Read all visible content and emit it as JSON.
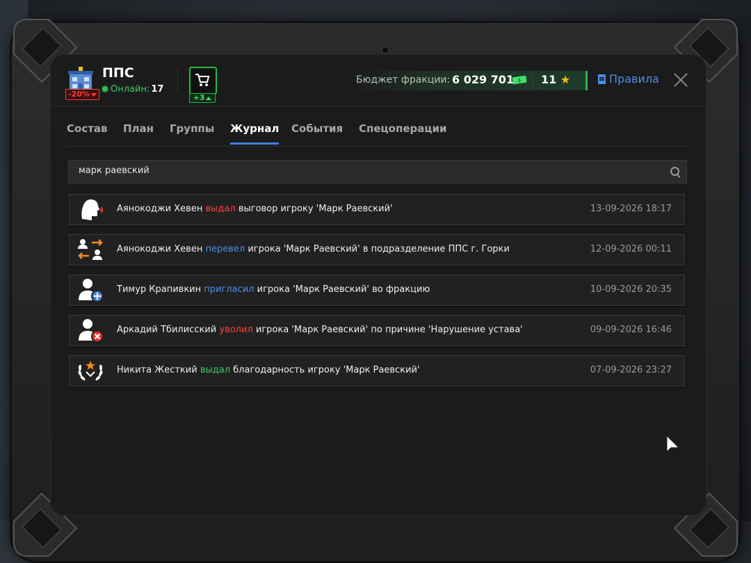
{
  "faction": {
    "name": "ППС",
    "discount": "-20%",
    "online_label": "Онлайн:",
    "online_count": "17"
  },
  "shop": {
    "badge": "+3"
  },
  "budget": {
    "label": "Бюджет фракции:",
    "value": "6 029 701",
    "stars": "11"
  },
  "rules_label": "Правила",
  "tabs": [
    {
      "label": "Состав",
      "active": false
    },
    {
      "label": "План",
      "active": false
    },
    {
      "label": "Группы",
      "active": false
    },
    {
      "label": "Журнал",
      "active": true
    },
    {
      "label": "События",
      "active": false
    },
    {
      "label": "Спецоперации",
      "active": false
    }
  ],
  "search": {
    "value": "марк раевский"
  },
  "log": [
    {
      "icon": "speaking-head-icon",
      "actor": "Аянокоджи Хевен",
      "action": "выдал",
      "action_color": "red",
      "rest": "выговор игроку 'Марк Раевский'",
      "date": "13-09-2026 18:17"
    },
    {
      "icon": "transfer-users-icon",
      "actor": "Аянокоджи Хевен",
      "action": "перевел",
      "action_color": "blue",
      "rest": "игрока 'Марк Раевский' в подразделение ППС г. Горки",
      "date": "12-09-2026 00:11"
    },
    {
      "icon": "user-add-icon",
      "actor": "Тимур Крапивкин",
      "action": "пригласил",
      "action_color": "blue",
      "rest": "игрока 'Марк Раевский' во фракцию",
      "date": "10-09-2026 20:35"
    },
    {
      "icon": "user-remove-icon",
      "actor": "Аркадий Тбилисский",
      "action": "уволил",
      "action_color": "red",
      "rest": "игрока 'Марк Раевский' по причине 'Нарушение устава'",
      "date": "09-09-2026 16:46"
    },
    {
      "icon": "laurel-star-icon",
      "actor": "Никита Жесткий",
      "action": "выдал",
      "action_color": "green",
      "rest": "благодарность игроку 'Марк Раевский'",
      "date": "07-09-2026 23:27"
    }
  ],
  "colors": {
    "accent": "#3f7fe0",
    "green": "#27b84f",
    "red": "#ff4040"
  }
}
